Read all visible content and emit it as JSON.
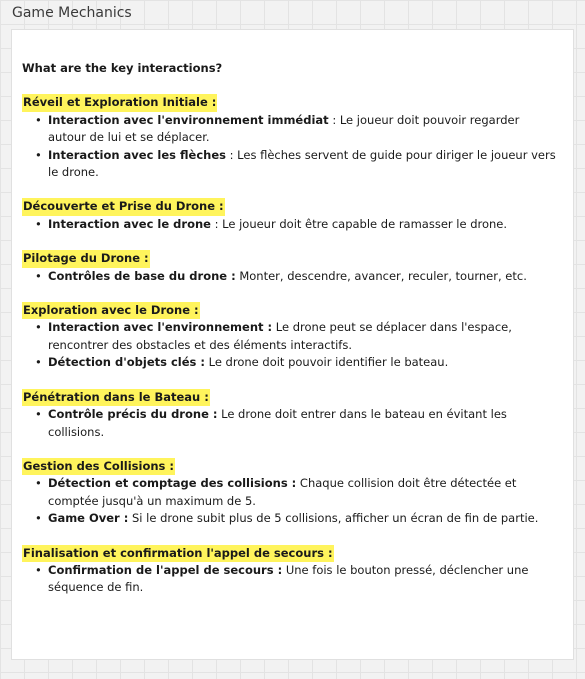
{
  "frame": {
    "title": "Game Mechanics"
  },
  "doc": {
    "question": "What are the key interactions?",
    "sections": [
      {
        "title": "Réveil et Exploration Initiale :",
        "items": [
          {
            "label": "Interaction avec l'environnement immédiat",
            "text": " : Le joueur doit pouvoir regarder autour de lui et se déplacer."
          },
          {
            "label": "Interaction avec les flèches",
            "text": " : Les flèches servent de guide pour diriger le joueur vers le drone."
          }
        ]
      },
      {
        "title": "Découverte et Prise du Drone :",
        "items": [
          {
            "label": "Interaction avec le drone",
            "text": " : Le joueur doit être capable de ramasser le drone."
          }
        ]
      },
      {
        "title": "Pilotage du Drone :",
        "items": [
          {
            "label": "Contrôles de base du drone :",
            "text": " Monter, descendre, avancer, reculer, tourner, etc."
          }
        ]
      },
      {
        "title": "Exploration avec le Drone :",
        "items": [
          {
            "label": "Interaction avec l'environnement :",
            "text": " Le drone peut se déplacer dans l'espace, rencontrer des obstacles et des éléments interactifs."
          },
          {
            "label": "Détection d'objets clés :",
            "text": " Le drone doit pouvoir identifier le bateau."
          }
        ]
      },
      {
        "title": "Pénétration dans le Bateau :",
        "items": [
          {
            "label": "Contrôle précis du drone :",
            "text": " Le drone doit entrer dans le bateau en évitant les collisions."
          }
        ]
      },
      {
        "title": "Gestion des Collisions :",
        "items": [
          {
            "label": "Détection et comptage des collisions :",
            "text": " Chaque collision doit être détectée et comptée jusqu'à un maximum de 5."
          },
          {
            "label": "Game Over :",
            "text": " Si le drone subit plus de 5 collisions, afficher un écran de fin de partie."
          }
        ]
      },
      {
        "title": "Finalisation et confirmation l'appel de secours :",
        "items": [
          {
            "label": "Confirmation de l'appel de secours :",
            "text": " Une fois le bouton pressé, déclencher une séquence de fin."
          }
        ]
      }
    ]
  },
  "colors": {
    "highlight": "#fff45c",
    "canvas": "#f2f2f2",
    "card": "#ffffff",
    "text": "#1a1a1a"
  },
  "icons": {
    "bullet": "bullet-dot-icon"
  }
}
